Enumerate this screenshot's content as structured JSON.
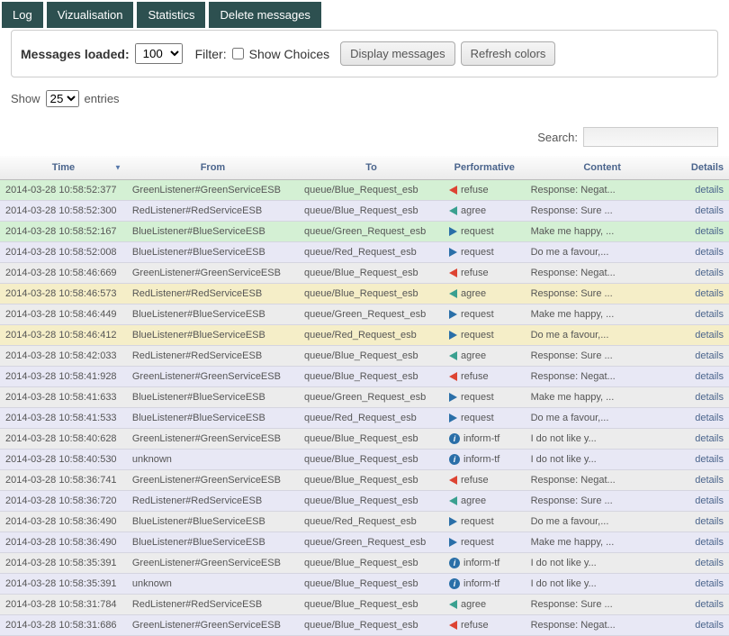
{
  "tabs": [
    "Log",
    "Vizualisation",
    "Statistics",
    "Delete messages"
  ],
  "filter": {
    "loaded_label": "Messages loaded:",
    "loaded_value": "100",
    "filter_label": "Filter:",
    "show_choices_label": "Show Choices",
    "display_btn": "Display messages",
    "refresh_btn": "Refresh colors"
  },
  "show": {
    "label_show": "Show",
    "value": "25",
    "label_entries": "entries"
  },
  "search": {
    "label": "Search:",
    "value": ""
  },
  "columns": {
    "time": "Time",
    "from": "From",
    "to": "To",
    "perf": "Performative",
    "content": "Content",
    "details": "Details"
  },
  "details_label": "details",
  "rows": [
    {
      "time": "2014-03-28 10:58:52:377",
      "from": "GreenListener#GreenServiceESB",
      "to": "queue/Blue_Request_esb",
      "perf": "refuse",
      "icon": "tri-left",
      "color": "c-red",
      "content": "Response: Negat...",
      "cls": "row-green"
    },
    {
      "time": "2014-03-28 10:58:52:300",
      "from": "RedListener#RedServiceESB",
      "to": "queue/Blue_Request_esb",
      "perf": "agree",
      "icon": "tri-left",
      "color": "c-teal",
      "content": "Response: Sure ...",
      "cls": "row-lavender"
    },
    {
      "time": "2014-03-28 10:58:52:167",
      "from": "BlueListener#BlueServiceESB",
      "to": "queue/Green_Request_esb",
      "perf": "request",
      "icon": "tri-right",
      "color": "c-blue",
      "content": "Make me happy, ...",
      "cls": "row-green"
    },
    {
      "time": "2014-03-28 10:58:52:008",
      "from": "BlueListener#BlueServiceESB",
      "to": "queue/Red_Request_esb",
      "perf": "request",
      "icon": "tri-right",
      "color": "c-blue",
      "content": "Do me a favour,...",
      "cls": "row-lavender"
    },
    {
      "time": "2014-03-28 10:58:46:669",
      "from": "GreenListener#GreenServiceESB",
      "to": "queue/Blue_Request_esb",
      "perf": "refuse",
      "icon": "tri-left",
      "color": "c-red",
      "content": "Response: Negat...",
      "cls": "row-grey"
    },
    {
      "time": "2014-03-28 10:58:46:573",
      "from": "RedListener#RedServiceESB",
      "to": "queue/Blue_Request_esb",
      "perf": "agree",
      "icon": "tri-left",
      "color": "c-teal",
      "content": "Response: Sure ...",
      "cls": "row-cream"
    },
    {
      "time": "2014-03-28 10:58:46:449",
      "from": "BlueListener#BlueServiceESB",
      "to": "queue/Green_Request_esb",
      "perf": "request",
      "icon": "tri-right",
      "color": "c-blue",
      "content": "Make me happy, ...",
      "cls": "row-grey"
    },
    {
      "time": "2014-03-28 10:58:46:412",
      "from": "BlueListener#BlueServiceESB",
      "to": "queue/Red_Request_esb",
      "perf": "request",
      "icon": "tri-right",
      "color": "c-blue",
      "content": "Do me a favour,...",
      "cls": "row-cream"
    },
    {
      "time": "2014-03-28 10:58:42:033",
      "from": "RedListener#RedServiceESB",
      "to": "queue/Blue_Request_esb",
      "perf": "agree",
      "icon": "tri-left",
      "color": "c-teal",
      "content": "Response: Sure ...",
      "cls": "row-grey"
    },
    {
      "time": "2014-03-28 10:58:41:928",
      "from": "GreenListener#GreenServiceESB",
      "to": "queue/Blue_Request_esb",
      "perf": "refuse",
      "icon": "tri-left",
      "color": "c-red",
      "content": "Response: Negat...",
      "cls": "row-lavender"
    },
    {
      "time": "2014-03-28 10:58:41:633",
      "from": "BlueListener#BlueServiceESB",
      "to": "queue/Green_Request_esb",
      "perf": "request",
      "icon": "tri-right",
      "color": "c-blue",
      "content": "Make me happy, ...",
      "cls": "row-grey"
    },
    {
      "time": "2014-03-28 10:58:41:533",
      "from": "BlueListener#BlueServiceESB",
      "to": "queue/Red_Request_esb",
      "perf": "request",
      "icon": "tri-right",
      "color": "c-blue",
      "content": "Do me a favour,...",
      "cls": "row-lavender"
    },
    {
      "time": "2014-03-28 10:58:40:628",
      "from": "GreenListener#GreenServiceESB",
      "to": "queue/Blue_Request_esb",
      "perf": "inform-tf",
      "icon": "info",
      "color": "",
      "content": "I do not like y...",
      "cls": "row-grey"
    },
    {
      "time": "2014-03-28 10:58:40:530",
      "from": "unknown",
      "to": "queue/Blue_Request_esb",
      "perf": "inform-tf",
      "icon": "info",
      "color": "",
      "content": "I do not like y...",
      "cls": "row-lavender"
    },
    {
      "time": "2014-03-28 10:58:36:741",
      "from": "GreenListener#GreenServiceESB",
      "to": "queue/Blue_Request_esb",
      "perf": "refuse",
      "icon": "tri-left",
      "color": "c-red",
      "content": "Response: Negat...",
      "cls": "row-grey"
    },
    {
      "time": "2014-03-28 10:58:36:720",
      "from": "RedListener#RedServiceESB",
      "to": "queue/Blue_Request_esb",
      "perf": "agree",
      "icon": "tri-left",
      "color": "c-teal",
      "content": "Response: Sure ...",
      "cls": "row-lavender"
    },
    {
      "time": "2014-03-28 10:58:36:490",
      "from": "BlueListener#BlueServiceESB",
      "to": "queue/Red_Request_esb",
      "perf": "request",
      "icon": "tri-right",
      "color": "c-blue",
      "content": "Do me a favour,...",
      "cls": "row-grey"
    },
    {
      "time": "2014-03-28 10:58:36:490",
      "from": "BlueListener#BlueServiceESB",
      "to": "queue/Green_Request_esb",
      "perf": "request",
      "icon": "tri-right",
      "color": "c-blue",
      "content": "Make me happy, ...",
      "cls": "row-lavender"
    },
    {
      "time": "2014-03-28 10:58:35:391",
      "from": "GreenListener#GreenServiceESB",
      "to": "queue/Blue_Request_esb",
      "perf": "inform-tf",
      "icon": "info",
      "color": "",
      "content": "I do not like y...",
      "cls": "row-grey"
    },
    {
      "time": "2014-03-28 10:58:35:391",
      "from": "unknown",
      "to": "queue/Blue_Request_esb",
      "perf": "inform-tf",
      "icon": "info",
      "color": "",
      "content": "I do not like y...",
      "cls": "row-lavender"
    },
    {
      "time": "2014-03-28 10:58:31:784",
      "from": "RedListener#RedServiceESB",
      "to": "queue/Blue_Request_esb",
      "perf": "agree",
      "icon": "tri-left",
      "color": "c-teal",
      "content": "Response: Sure ...",
      "cls": "row-grey"
    },
    {
      "time": "2014-03-28 10:58:31:686",
      "from": "GreenListener#GreenServiceESB",
      "to": "queue/Blue_Request_esb",
      "perf": "refuse",
      "icon": "tri-left",
      "color": "c-red",
      "content": "Response: Negat...",
      "cls": "row-lavender"
    }
  ]
}
